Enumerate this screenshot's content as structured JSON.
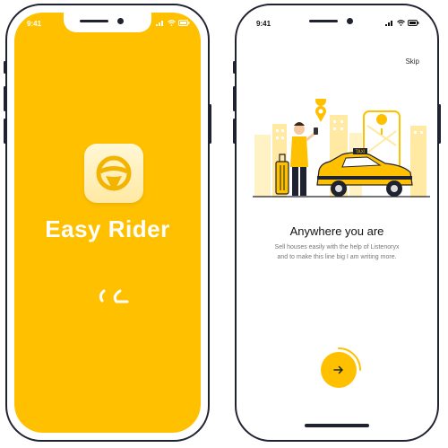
{
  "splash": {
    "time": "9:41",
    "app_name": "Easy Rider",
    "brand_color": "#ffc000",
    "icons": [
      "signal-icon",
      "wifi-icon",
      "battery-icon",
      "steering-wheel-icon",
      "loading-spinner-icon"
    ]
  },
  "onboarding": {
    "time": "9:41",
    "skip_label": "Skip",
    "heading": "Anywhere you are",
    "description": "Sell houses easily with the help of Listenoryx and to make this line big I am writing more.",
    "illustration_sign": "TAXI",
    "next_icon": "arrow-right-icon"
  }
}
